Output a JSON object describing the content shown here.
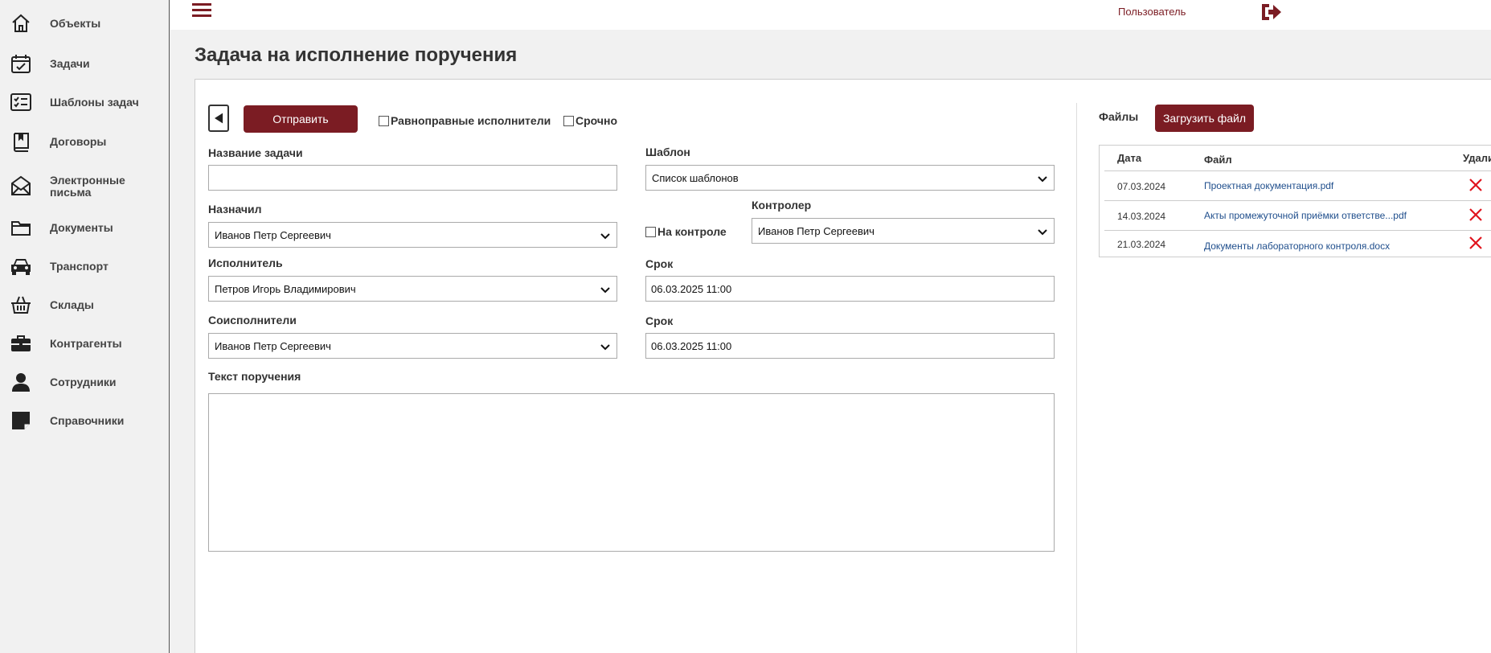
{
  "sidebar": {
    "items": [
      {
        "label": "Объекты",
        "icon": "home-icon"
      },
      {
        "label": "Задачи",
        "icon": "calendar-check-icon"
      },
      {
        "label": "Шаблоны задач",
        "icon": "checklist-icon"
      },
      {
        "label": "Договоры",
        "icon": "book-icon"
      },
      {
        "label": "Электронные письма",
        "icon": "envelope-icon"
      },
      {
        "label": "Документы",
        "icon": "folder-icon"
      },
      {
        "label": "Транспорт",
        "icon": "car-icon"
      },
      {
        "label": "Склады",
        "icon": "basket-icon"
      },
      {
        "label": "Контрагенты",
        "icon": "briefcase-icon"
      },
      {
        "label": "Сотрудники",
        "icon": "user-icon"
      },
      {
        "label": "Справочники",
        "icon": "note-icon"
      }
    ]
  },
  "header": {
    "user_label": "Пользователь",
    "menu_icon": "hamburger-icon",
    "logout_icon": "logout-icon"
  },
  "page": {
    "title": "Задача на исполнение поручения"
  },
  "toolbar": {
    "send_label": "Отправить",
    "equal_executors_label": "Равноправные исполнители",
    "urgent_label": "Срочно"
  },
  "form": {
    "task_name_label": "Название задачи",
    "task_name_value": "",
    "template_label": "Шаблон",
    "template_value": "Список шаблонов",
    "assigned_label": "Назначил",
    "assigned_value": "Иванов Петр Сергеевич",
    "on_control_label": "На контроле",
    "controller_label": "Контролер",
    "controller_value": "Иванов Петр Сергеевич",
    "executor_label": "Исполнитель",
    "executor_value": "Петров Игорь Владимирович",
    "deadline1_label": "Срок",
    "deadline1_value": "06.03.2025 11:00",
    "coexecutors_label": "Соисполнители",
    "coexecutors_value": "Иванов Петр Сергеевич",
    "deadline2_label": "Срок",
    "deadline2_value": "06.03.2025 11:00",
    "instruction_label": "Текст поручения",
    "instruction_value": ""
  },
  "files": {
    "label": "Файлы",
    "upload_label": "Загрузить файл",
    "columns": [
      "Дата",
      "Файл",
      "Удали"
    ],
    "rows": [
      {
        "date": "07.03.2024",
        "file": "Проектная документация.pdf"
      },
      {
        "date": "14.03.2024",
        "file": "Акты промежуточной приёмки ответстве...pdf"
      },
      {
        "date": "21.03.2024",
        "file": "Документы лабораторного контроля.docx"
      }
    ]
  },
  "colors": {
    "accent": "#7b1c23",
    "link": "#1f4e8c",
    "delete": "#e0141e"
  }
}
